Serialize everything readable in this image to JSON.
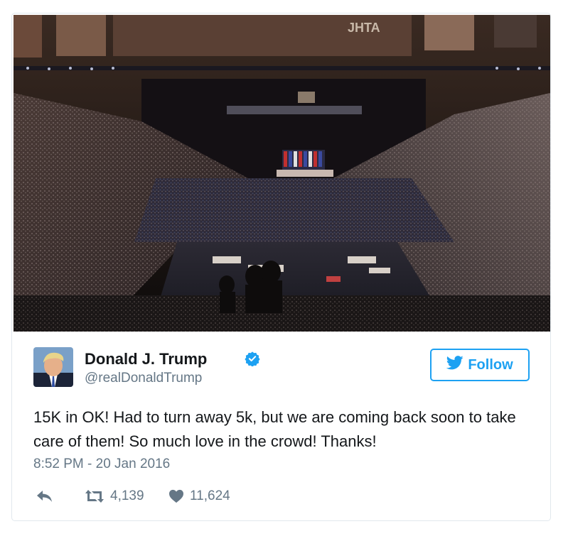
{
  "tweet": {
    "author_name": "Donald J. Trump",
    "handle": "@realDonaldTrump",
    "follow_label": "Follow",
    "text": "15K in OK! Had to turn away 5k, but we are coming back soon to take care of them! So much love in the crowd! Thanks!",
    "timestamp": "8:52 PM - 20 Jan 2016",
    "retweets": "4,139",
    "likes": "11,624",
    "verified": true
  },
  "media": {
    "type": "photo",
    "banner_text": "JHTA"
  },
  "icons": {
    "reply": "reply-icon",
    "retweet": "retweet-icon",
    "like": "heart-icon",
    "verified": "verified-badge-icon",
    "twitter": "twitter-bird-icon"
  },
  "colors": {
    "brand": "#1da1f2",
    "text": "#14171a",
    "muted": "#657786",
    "border": "#e1e8ed"
  }
}
